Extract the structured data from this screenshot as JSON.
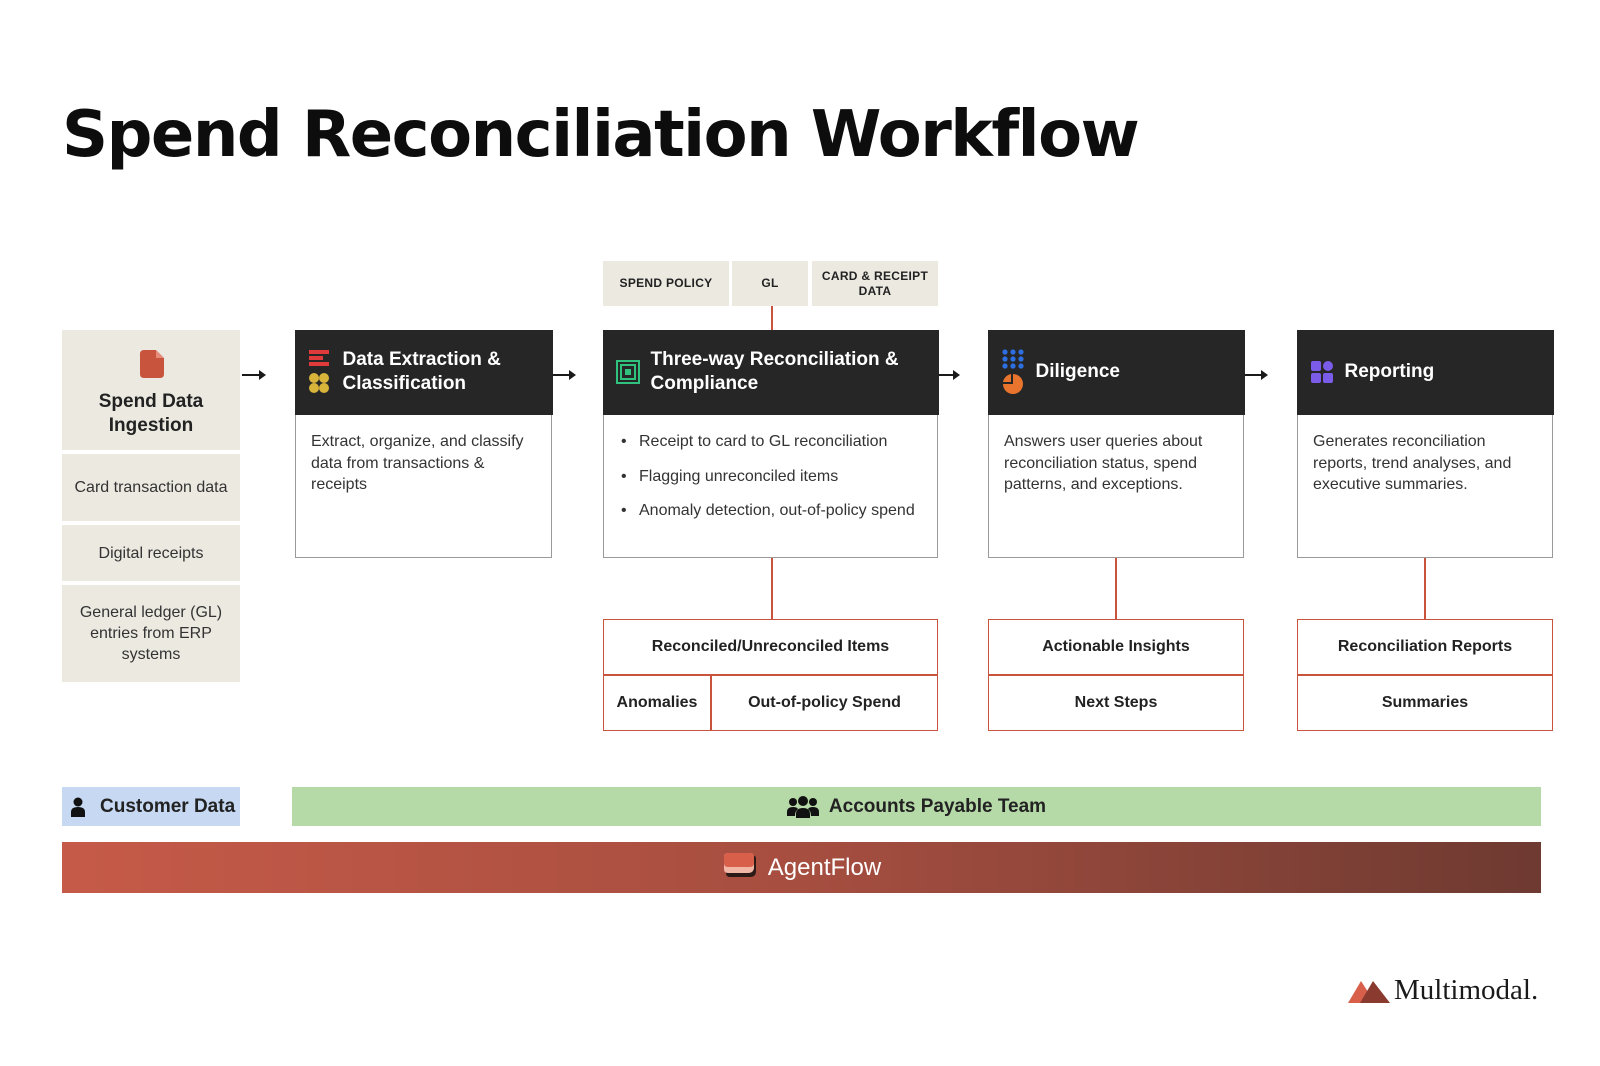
{
  "title": "Spend Reconciliation Workflow",
  "ingestion": {
    "label": "Spend Data Ingestion",
    "items": [
      "Card transaction data",
      "Digital receipts",
      "General ledger (GL) entries from ERP systems"
    ]
  },
  "inputs": [
    "SPEND POLICY",
    "GL",
    "CARD & RECEIPT DATA"
  ],
  "steps": [
    {
      "title": "Data Extraction & Classification",
      "body": "Extract, organize, and classify data from transactions & receipts"
    },
    {
      "title": "Three-way Reconciliation & Compliance",
      "bullets": [
        "Receipt to card to GL reconciliation",
        "Flagging unreconciled items",
        "Anomaly detection, out-of-policy spend"
      ]
    },
    {
      "title": "Diligence",
      "body": "Answers user queries about reconciliation status, spend patterns, and exceptions."
    },
    {
      "title": "Reporting",
      "body": "Generates reconciliation reports, trend analyses, and executive summaries."
    }
  ],
  "outputs": {
    "reconciliation": {
      "top": "Reconciled/Unreconciled Items",
      "left": "Anomalies",
      "right": "Out-of-policy Spend"
    },
    "diligence": [
      "Actionable Insights",
      "Next Steps"
    ],
    "reporting": [
      "Reconciliation Reports",
      "Summaries"
    ]
  },
  "bars": {
    "customer_data": "Customer Data",
    "ap_team": "Accounts Payable Team",
    "agentflow": "AgentFlow"
  },
  "brand": "Multimodal.",
  "colors": {
    "accent_red": "#c9543e",
    "card_header": "#262626",
    "panel_beige": "#ece9e1",
    "customer_blue": "#c6d8f2",
    "ap_green": "#b6d9a8",
    "diligence_blue": "#2d6fe0",
    "diligence_orange": "#e8742d",
    "reporting_purple": "#7b5ce8",
    "compliance_green": "#2ec27e"
  }
}
